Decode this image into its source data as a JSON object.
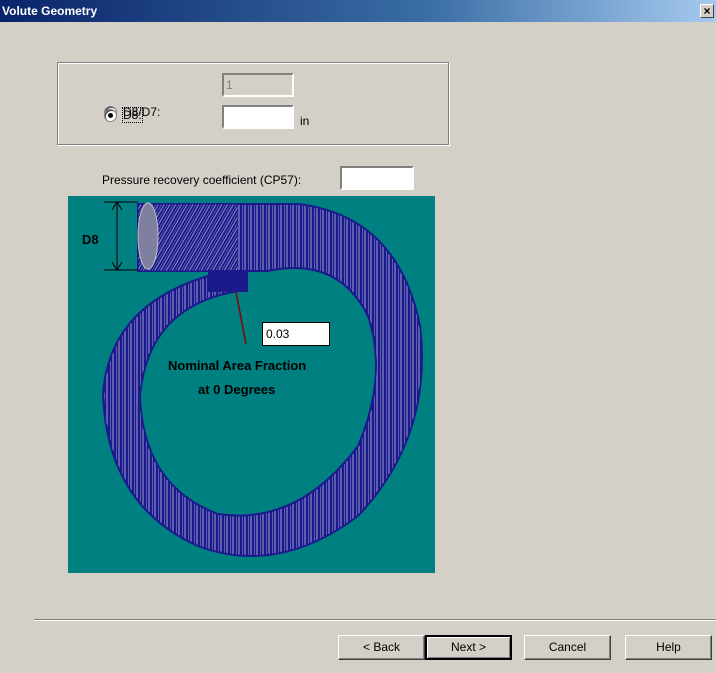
{
  "window": {
    "title": "Volute Geometry",
    "close_glyph": "×"
  },
  "options": {
    "ratio": {
      "label": "D8/D7:",
      "value": "1",
      "selected": false
    },
    "d8": {
      "label": "D8:",
      "value": "",
      "unit": "in",
      "selected": true
    }
  },
  "pressure": {
    "label": "Pressure recovery coefficient (CP57):",
    "value": ""
  },
  "diagram": {
    "d8_label": "D8",
    "area_fraction_value": "0.03",
    "annotation_line1": "Nominal Area Fraction",
    "annotation_line2": "at 0 Degrees",
    "colors": {
      "background": "#008080",
      "volute": "#1a1a8c",
      "mesh": "#ffffff"
    }
  },
  "buttons": {
    "back": "< Back",
    "next": "Next >",
    "cancel": "Cancel",
    "help": "Help"
  }
}
